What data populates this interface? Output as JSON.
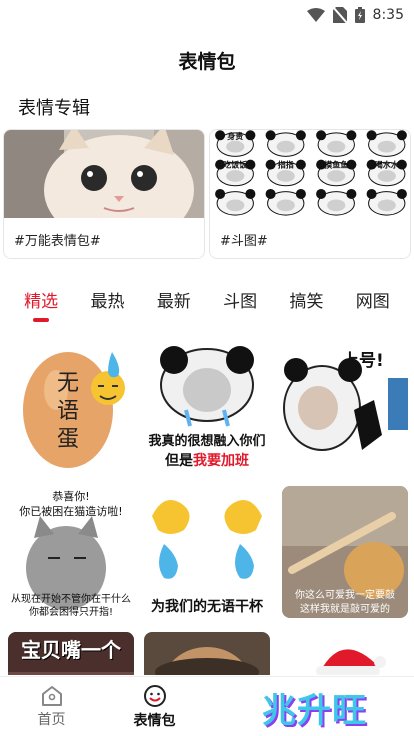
{
  "status": {
    "time": "8:35"
  },
  "app": {
    "title": "表情包"
  },
  "albums": {
    "section_title": "表情专辑",
    "items": [
      {
        "label": "#万能表情包#"
      },
      {
        "label": "#斗图#"
      }
    ],
    "doutu_captions": [
      "身贵",
      "指指",
      "摸鱼鱼",
      "喝水水",
      "吃饭饭"
    ]
  },
  "tabs": [
    {
      "label": "精选",
      "active": true
    },
    {
      "label": "最热"
    },
    {
      "label": "最新"
    },
    {
      "label": "斗图"
    },
    {
      "label": "搞笑"
    },
    {
      "label": "网图"
    }
  ],
  "stickers": {
    "egg_text": "无语蛋",
    "panda_line1": "我真的很想融入你们",
    "panda_line2_a": "但是",
    "panda_line2_b": "我要加班",
    "shanghao": "上号!",
    "cat_top1": "恭喜你!",
    "cat_top2": "你已被困在猫造访啦!",
    "cat_bottom1": "从现在开始不管你在干什么",
    "cat_bottom2": "你都会困得只开指!",
    "hands_caption": "为我们的无语干杯",
    "doge_caption1": "你这么可爱我一定要敲",
    "doge_caption2": "这样我就是敲可爱的",
    "baobei": "宝贝嘴一个"
  },
  "bottom_nav": [
    {
      "label": "首页",
      "icon": "home-icon"
    },
    {
      "label": "表情包",
      "icon": "smile-icon",
      "active": true
    },
    {
      "label": "",
      "icon": ""
    },
    {
      "label": "",
      "icon": ""
    }
  ],
  "watermark": "兆升旺",
  "colors": {
    "accent": "#e0192b",
    "watermark": "#3fc6e8"
  }
}
